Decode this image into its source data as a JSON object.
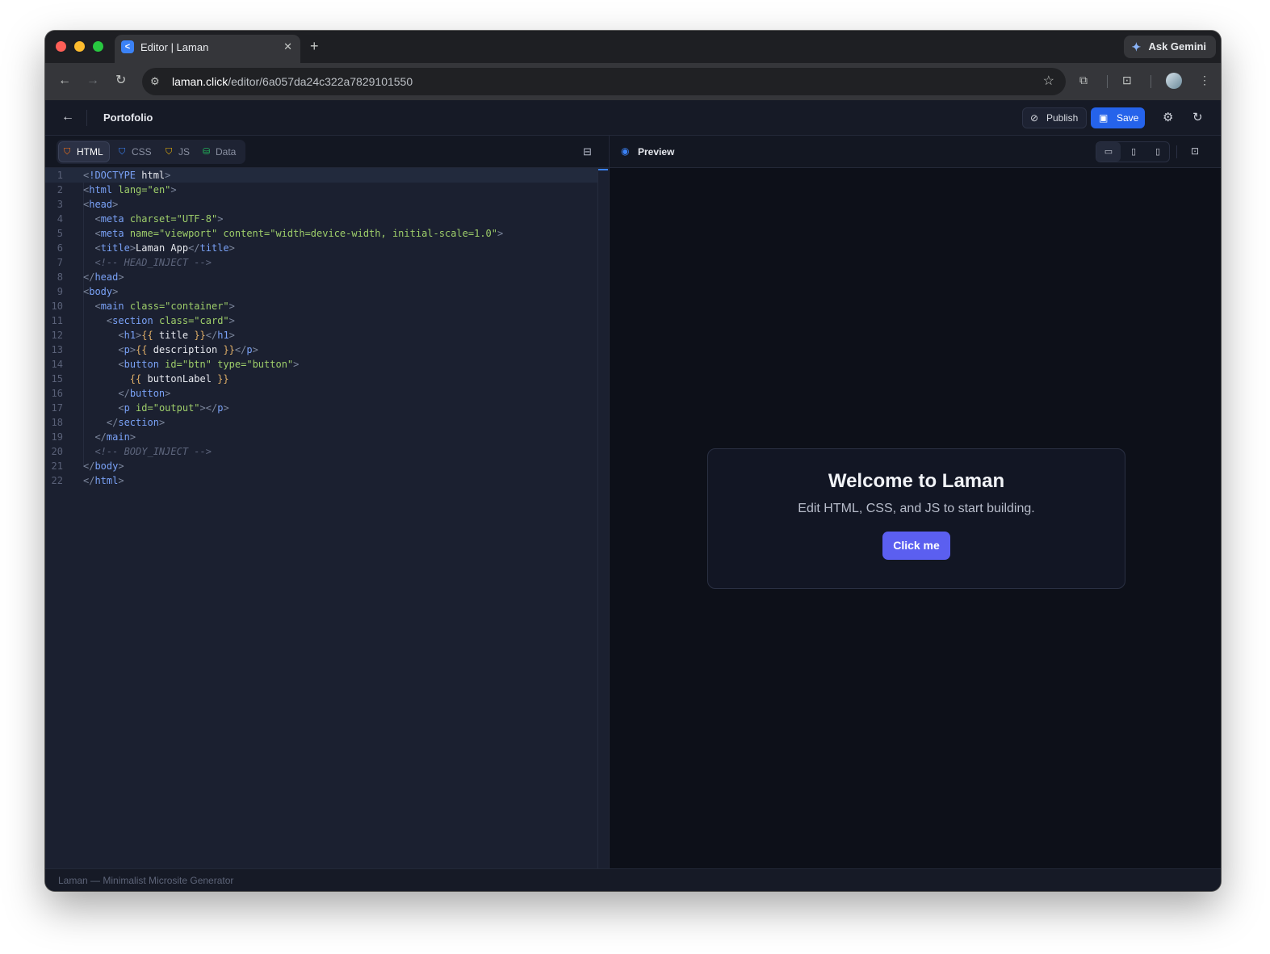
{
  "browser": {
    "tab_title": "Editor | Laman",
    "tab_favicon": "<",
    "close_glyph": "✕",
    "newtab_glyph": "+",
    "ask_gemini": "Ask Gemini",
    "url_host": "laman.click",
    "url_path": "/editor/6a057da24c322a7829101550",
    "icons": [
      "back-arrow-icon",
      "forward-arrow-icon",
      "reload-icon",
      "site-info-icon",
      "star-icon",
      "extensions-icon",
      "tab-search-icon",
      "profile-avatar",
      "more-vert-icon"
    ]
  },
  "header": {
    "project_name": "Portofolio",
    "publish_label": "Publish",
    "save_label": "Save",
    "save_color": "#2563eb"
  },
  "editor": {
    "tabs": [
      {
        "label": "HTML",
        "color": "#f97316"
      },
      {
        "label": "CSS",
        "color": "#3b82f6"
      },
      {
        "label": "JS",
        "color": "#eab308"
      },
      {
        "label": "Data",
        "color": "#22c55e"
      }
    ],
    "active_tab": "HTML",
    "line_numbers": [
      "1",
      "2",
      "3",
      "4",
      "5",
      "6",
      "7",
      "8",
      "9",
      "10",
      "11",
      "12",
      "13",
      "14",
      "15",
      "16",
      "17",
      "18",
      "19",
      "20",
      "21",
      "22"
    ],
    "lines": [
      [
        [
          "punct",
          "<"
        ],
        [
          "tag",
          "!DOCTYPE"
        ],
        [
          "txt",
          " html"
        ],
        [
          "punct",
          ">"
        ]
      ],
      [
        [
          "punct",
          "<"
        ],
        [
          "tag",
          "html"
        ],
        [
          "attr",
          " lang="
        ],
        [
          "str",
          "\"en\""
        ],
        [
          "punct",
          ">"
        ]
      ],
      [
        [
          "punct",
          "<"
        ],
        [
          "tag",
          "head"
        ],
        [
          "punct",
          ">"
        ]
      ],
      [
        [
          "txt",
          "  "
        ],
        [
          "punct",
          "<"
        ],
        [
          "tag",
          "meta"
        ],
        [
          "attr",
          " charset="
        ],
        [
          "str",
          "\"UTF-8\""
        ],
        [
          "punct",
          ">"
        ]
      ],
      [
        [
          "txt",
          "  "
        ],
        [
          "punct",
          "<"
        ],
        [
          "tag",
          "meta"
        ],
        [
          "attr",
          " name="
        ],
        [
          "str",
          "\"viewport\""
        ],
        [
          "attr",
          " content="
        ],
        [
          "str",
          "\"width=device-width, initial-scale=1.0\""
        ],
        [
          "punct",
          ">"
        ]
      ],
      [
        [
          "txt",
          "  "
        ],
        [
          "punct",
          "<"
        ],
        [
          "tag",
          "title"
        ],
        [
          "punct",
          ">"
        ],
        [
          "txt",
          "Laman App"
        ],
        [
          "punct",
          "</"
        ],
        [
          "tag",
          "title"
        ],
        [
          "punct",
          ">"
        ]
      ],
      [
        [
          "txt",
          "  "
        ],
        [
          "comment",
          "<!-- HEAD_INJECT -->"
        ]
      ],
      [
        [
          "punct",
          "</"
        ],
        [
          "tag",
          "head"
        ],
        [
          "punct",
          ">"
        ]
      ],
      [
        [
          "punct",
          "<"
        ],
        [
          "tag",
          "body"
        ],
        [
          "punct",
          ">"
        ]
      ],
      [
        [
          "txt",
          "  "
        ],
        [
          "punct",
          "<"
        ],
        [
          "tag",
          "main"
        ],
        [
          "attr",
          " class="
        ],
        [
          "str",
          "\"container\""
        ],
        [
          "punct",
          ">"
        ]
      ],
      [
        [
          "txt",
          "    "
        ],
        [
          "punct",
          "<"
        ],
        [
          "tag",
          "section"
        ],
        [
          "attr",
          " class="
        ],
        [
          "str",
          "\"card\""
        ],
        [
          "punct",
          ">"
        ]
      ],
      [
        [
          "txt",
          "      "
        ],
        [
          "punct",
          "<"
        ],
        [
          "tag",
          "h1"
        ],
        [
          "punct",
          ">"
        ],
        [
          "brace",
          "{{"
        ],
        [
          "txt",
          " title "
        ],
        [
          "brace",
          "}}"
        ],
        [
          "punct",
          "</"
        ],
        [
          "tag",
          "h1"
        ],
        [
          "punct",
          ">"
        ]
      ],
      [
        [
          "txt",
          "      "
        ],
        [
          "punct",
          "<"
        ],
        [
          "tag",
          "p"
        ],
        [
          "punct",
          ">"
        ],
        [
          "brace",
          "{{"
        ],
        [
          "txt",
          " description "
        ],
        [
          "brace",
          "}}"
        ],
        [
          "punct",
          "</"
        ],
        [
          "tag",
          "p"
        ],
        [
          "punct",
          ">"
        ]
      ],
      [
        [
          "txt",
          "      "
        ],
        [
          "punct",
          "<"
        ],
        [
          "tag",
          "button"
        ],
        [
          "attr",
          " id="
        ],
        [
          "str",
          "\"btn\""
        ],
        [
          "attr",
          " type="
        ],
        [
          "str",
          "\"button\""
        ],
        [
          "punct",
          ">"
        ]
      ],
      [
        [
          "txt",
          "        "
        ],
        [
          "brace",
          "{{"
        ],
        [
          "txt",
          " buttonLabel "
        ],
        [
          "brace",
          "}}"
        ]
      ],
      [
        [
          "txt",
          "      "
        ],
        [
          "punct",
          "</"
        ],
        [
          "tag",
          "button"
        ],
        [
          "punct",
          ">"
        ]
      ],
      [
        [
          "txt",
          "      "
        ],
        [
          "punct",
          "<"
        ],
        [
          "tag",
          "p"
        ],
        [
          "attr",
          " id="
        ],
        [
          "str",
          "\"output\""
        ],
        [
          "punct",
          "></"
        ],
        [
          "tag",
          "p"
        ],
        [
          "punct",
          ">"
        ]
      ],
      [
        [
          "txt",
          "    "
        ],
        [
          "punct",
          "</"
        ],
        [
          "tag",
          "section"
        ],
        [
          "punct",
          ">"
        ]
      ],
      [
        [
          "txt",
          "  "
        ],
        [
          "punct",
          "</"
        ],
        [
          "tag",
          "main"
        ],
        [
          "punct",
          ">"
        ]
      ],
      [
        [
          "txt",
          "  "
        ],
        [
          "comment",
          "<!-- BODY_INJECT -->"
        ]
      ],
      [
        [
          "punct",
          "</"
        ],
        [
          "tag",
          "body"
        ],
        [
          "punct",
          ">"
        ]
      ],
      [
        [
          "punct",
          "</"
        ],
        [
          "tag",
          "html"
        ],
        [
          "punct",
          ">"
        ]
      ]
    ]
  },
  "preview": {
    "label": "Preview",
    "card_title": "Welcome to Laman",
    "card_description": "Edit HTML, CSS, and JS to start building.",
    "card_button": "Click me",
    "button_color": "#5b5ff0"
  },
  "footer": {
    "text": "Laman — Minimalist Microsite Generator"
  }
}
